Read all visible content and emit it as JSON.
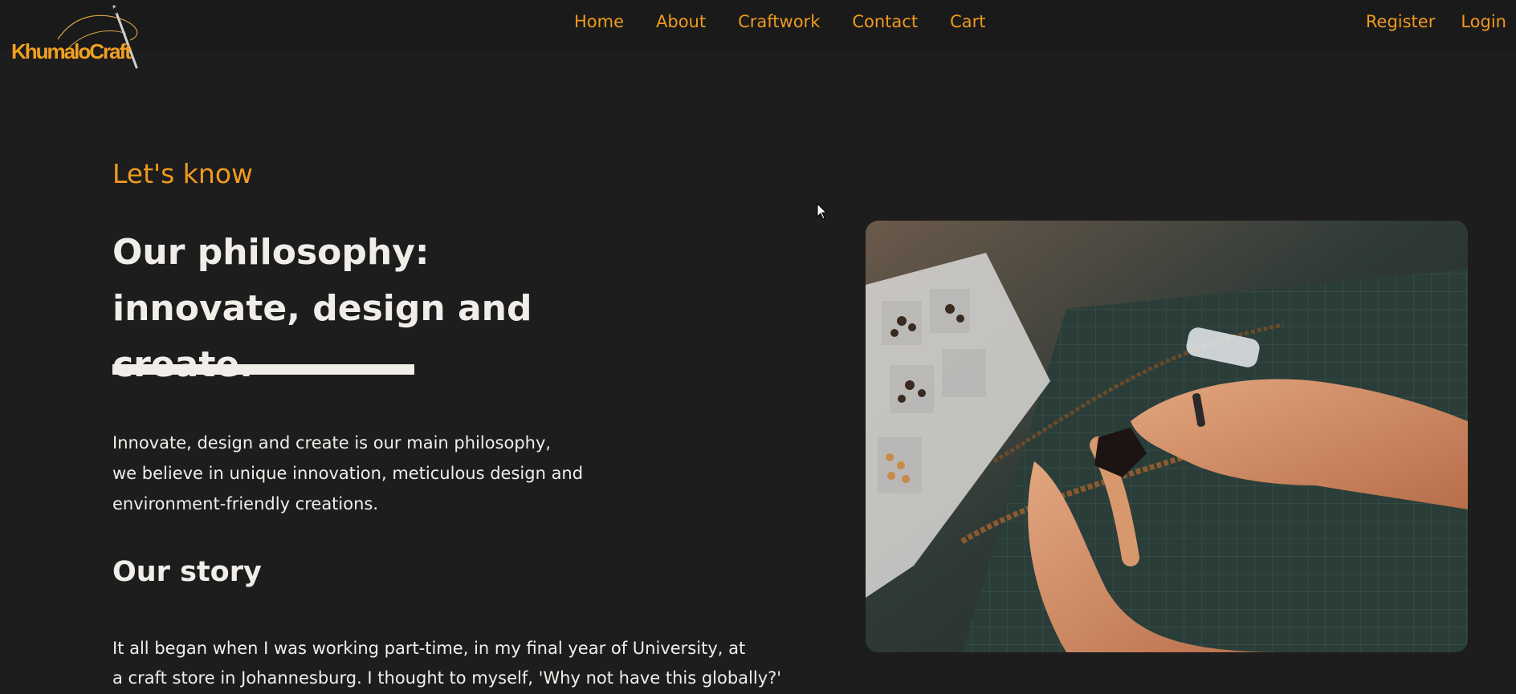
{
  "brand": {
    "name": "KhumaloCraft",
    "accent": "#f09a1f"
  },
  "nav": {
    "items": [
      {
        "label": "Home"
      },
      {
        "label": "About"
      },
      {
        "label": "Craftwork"
      },
      {
        "label": "Contact"
      },
      {
        "label": "Cart"
      }
    ]
  },
  "auth": {
    "register": "Register",
    "login": "Login"
  },
  "main": {
    "eyebrow": "Let's know",
    "headline": "Our philosophy: innovate, design and create.",
    "philosophy": "Innovate, design and create is our main philosophy,\nwe believe in unique innovation, meticulous design and\nenvironment-friendly creations.",
    "story_heading": "Our story",
    "story": "It all began when I was working part-time, in my final year of University, at\na craft store in Johannesburg. I thought to myself, 'Why not have this globally?'"
  },
  "image": {
    "subject": "hands crafting beaded jewelry on a cutting mat"
  },
  "colors": {
    "background": "#1d1d1d",
    "text": "#f1eeea",
    "accent": "#f09a1f"
  }
}
